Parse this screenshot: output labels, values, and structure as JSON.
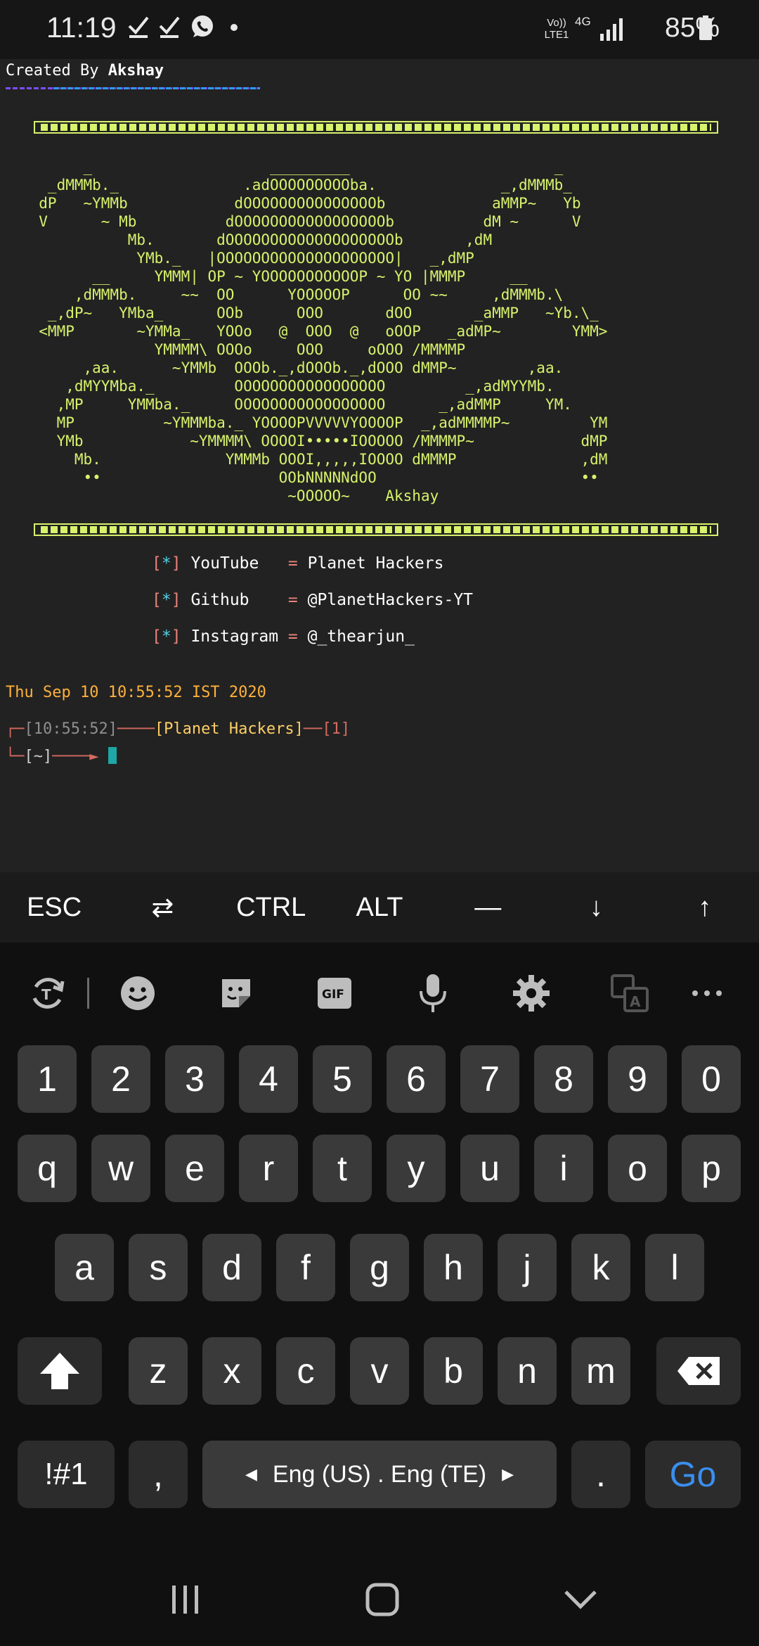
{
  "status_bar": {
    "time": "11:19",
    "network_volte": "Vo)) LTE1",
    "network_type": "4G",
    "battery": "85%",
    "left_icons": [
      "check-icon",
      "check-icon",
      "whatsapp-icon",
      "dot-icon"
    ],
    "right_icons": [
      "signal-icon",
      "battery-icon"
    ]
  },
  "terminal": {
    "created_prefix": "Created By ",
    "created_name": "Akshay",
    "ascii_art": "       _                    _________                       _\n   _dMMMb._              .adOOOOOOOOOba.              _,dMMMb_\n  dP   ~YMMb            dOOOOOOOOOOOOOOOb            aMMP~   Yb\n  V      ~ Mb          dOOOOOOOOOOOOOOOOOb          dM ~      V\n            Mb.       dOOOOOOOOOOOOOOOOOOOb       ,dM\n             YMb._   |OOOOOOOOOOOOOOOOOOOO|   _,dMP\n        __     YMMM| OP ~ YOOOOOOOOOOOP ~ YO |MMMP     __\n      ,dMMMb.     ~~  OO      YOOOOOP      OO ~~     ,dMMMb.\\\n   _,dP~   YMba_      OOb      OOO       dOO       _aMMP   ~Yb.\\_\n  <MMP       ~YMMa_   YOOo   @  OOO  @   oOOP   _adMP~        YMM>\n               YMMMM\\ OOOo     OOO     oOOO /MMMMP\n       ,aa.      ~YMMb  OOOb._,dOOOb._,dOOO dMMP~        ,aa.\n     ,dMYYMba._         OOOOOOOOOOOOOOOOO         _,adMYYMb.\n    ,MP     YMMba._     OOOOOOOOOOOOOOOOO      _,adMMP     YM.\n    MP          ~YMMMba._ YOOOOPVVVVVYOOOOP  _,adMMMMP~         YM\n    YMb            ~YMMMM\\ OOOOI•••••IOOOOO /MMMMP~            dMP\n      Mb.              YMMMb OOOI,,,,,IOOOO dMMMP              ,dM\n       ••                    OObNNNNNdOO                       ••\n                              ~OOOOO~    Akshay",
    "info_lines": [
      {
        "marker": "[*]",
        "label": "YouTube  ",
        "sep": " = ",
        "value": "Planet Hackers"
      },
      {
        "marker": "[*]",
        "label": "Github   ",
        "sep": " = ",
        "value": "@PlanetHackers-YT"
      },
      {
        "marker": "[*]",
        "label": "Instagram",
        "sep": " = ",
        "value": "@_thearjun_"
      }
    ],
    "datetime": "Thu Sep 10 10:55:52 IST 2020",
    "prompt_time": "[10:55:52]",
    "prompt_host": "[Planet Hackers]",
    "prompt_num": "[1]",
    "prompt_dir": "[~]",
    "colors": {
      "accent": "#d7f26c",
      "date": "#ffb13b",
      "cursor": "#1fa6a6"
    }
  },
  "extra_keys": [
    "ESC",
    "⇄",
    "CTRL",
    "ALT",
    "—",
    "↓",
    "↑"
  ],
  "keyboard": {
    "toolbar_icons": [
      "rotate-icon",
      "emoji-icon",
      "sticker-icon",
      "gif-icon",
      "mic-icon",
      "settings-icon",
      "translate-icon",
      "more-icon"
    ],
    "row_numbers": [
      "1",
      "2",
      "3",
      "4",
      "5",
      "6",
      "7",
      "8",
      "9",
      "0"
    ],
    "row_top": [
      "q",
      "w",
      "e",
      "r",
      "t",
      "y",
      "u",
      "i",
      "o",
      "p"
    ],
    "row_middle": [
      "a",
      "s",
      "d",
      "f",
      "g",
      "h",
      "j",
      "k",
      "l"
    ],
    "row_bottom": [
      "z",
      "x",
      "c",
      "v",
      "b",
      "n",
      "m"
    ],
    "symbols_key": "!#1",
    "comma_key": ",",
    "space_label": "Eng (US) . Eng (TE)",
    "period_key": ".",
    "go_key": "Go",
    "go_color": "#3a8eef"
  },
  "nav_bar": {
    "icons": [
      "recents-icon",
      "home-icon",
      "back-icon"
    ]
  }
}
